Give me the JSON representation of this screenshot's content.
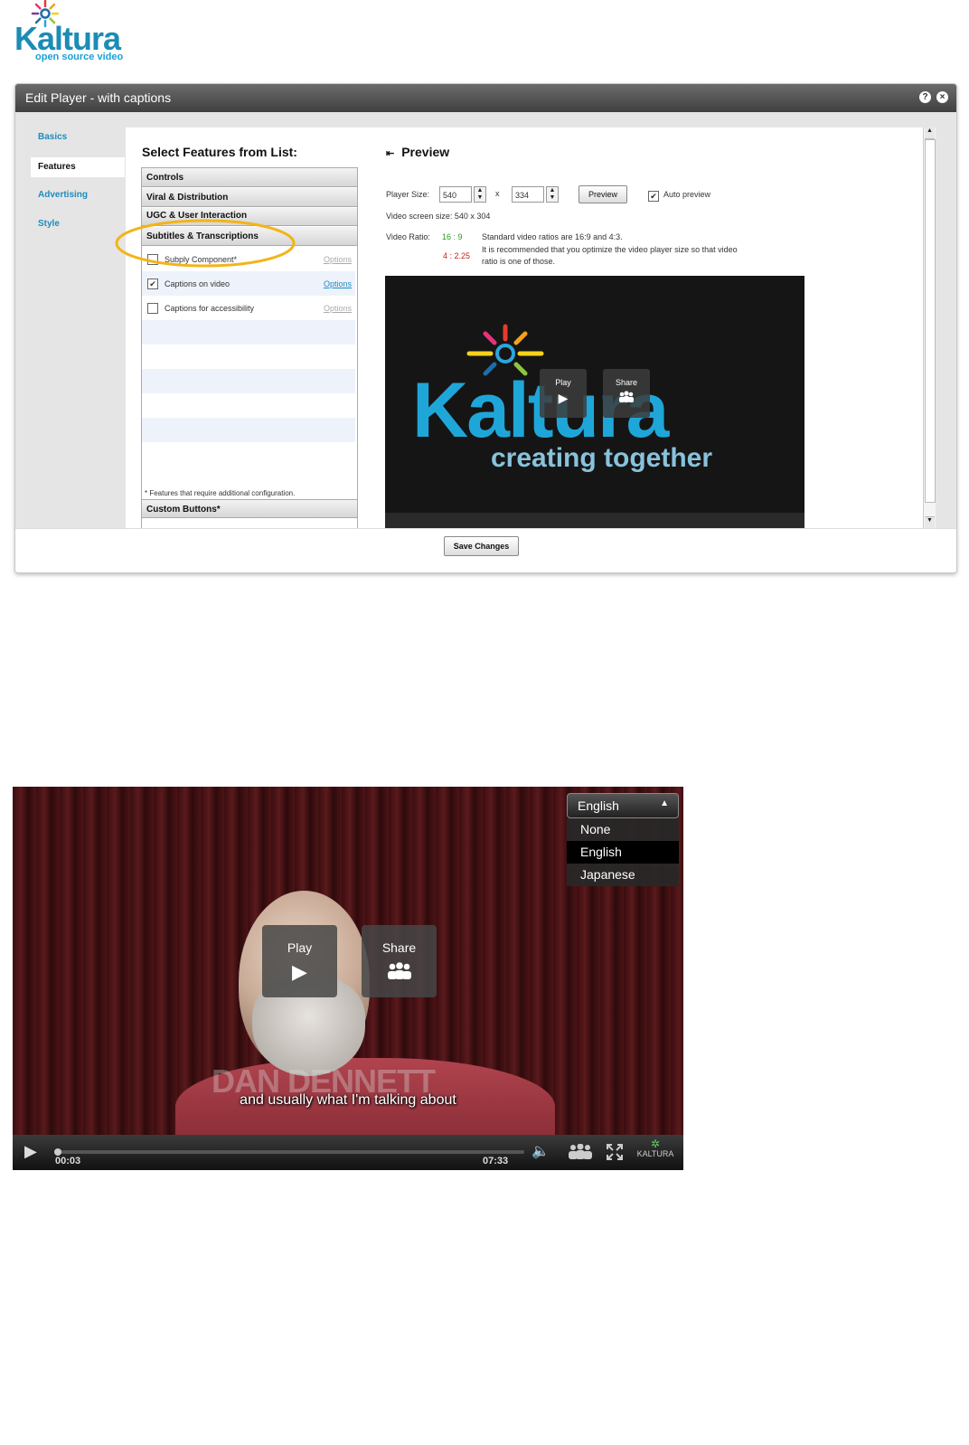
{
  "logo": {
    "word": "Kaltura",
    "tagline": "open source video"
  },
  "dialog": {
    "title": "Edit Player - with captions",
    "help_icon": "?",
    "close_icon": "×",
    "nav": [
      {
        "label": "Basics"
      },
      {
        "label": "Features"
      },
      {
        "label": "Advertising"
      },
      {
        "label": "Style"
      }
    ],
    "features": {
      "title": "Select Features from List:",
      "groups": [
        "Controls",
        "Viral & Distribution",
        "UGC & User Interaction",
        "Subtitles & Transcriptions"
      ],
      "items": [
        {
          "label": "Subply Component*",
          "option": "Options",
          "checked": false
        },
        {
          "label": "Captions on video",
          "option": "Options",
          "checked": true
        },
        {
          "label": "Captions for accessibility",
          "option": "Options",
          "checked": false
        }
      ],
      "footnote": "* Features that require additional configuration.",
      "last_group": "Custom Buttons*"
    },
    "preview": {
      "title": "Preview",
      "player_size_label": "Player Size:",
      "width": "540",
      "x": "x",
      "height": "334",
      "preview_button": "Preview",
      "auto_preview": "Auto preview",
      "screen_size": "Video screen size: 540 x 304",
      "ratio_label": "Video Ratio:",
      "ratio_good": "16 : 9",
      "ratio_bad": "4 : 2.25",
      "ratio_note1": "Standard video ratios are 16:9 and 4:3.",
      "ratio_note2": "It is recommended that you optimize the video player size so that video",
      "ratio_note3": "ratio is one of those.",
      "video_word": "Kaltura",
      "video_slogan": "creating together",
      "play_label": "Play",
      "share_label": "Share"
    },
    "save_button": "Save Changes"
  },
  "player": {
    "language_selected": "English",
    "languages": [
      "None",
      "English",
      "Japanese"
    ],
    "selected_index": 1,
    "play_label": "Play",
    "share_label": "Share",
    "watermark": "DAN DENNETT",
    "caption": "and usually what I'm talking about",
    "time_current": "00:03",
    "time_total": "07:33",
    "brand": "KALTURA",
    "progress_fraction": 0.007
  },
  "colors": {
    "accent": "#1d8cc0",
    "annotation": "#f2b418",
    "ratio_good": "#2a9a1d",
    "ratio_bad": "#d21a1a"
  }
}
